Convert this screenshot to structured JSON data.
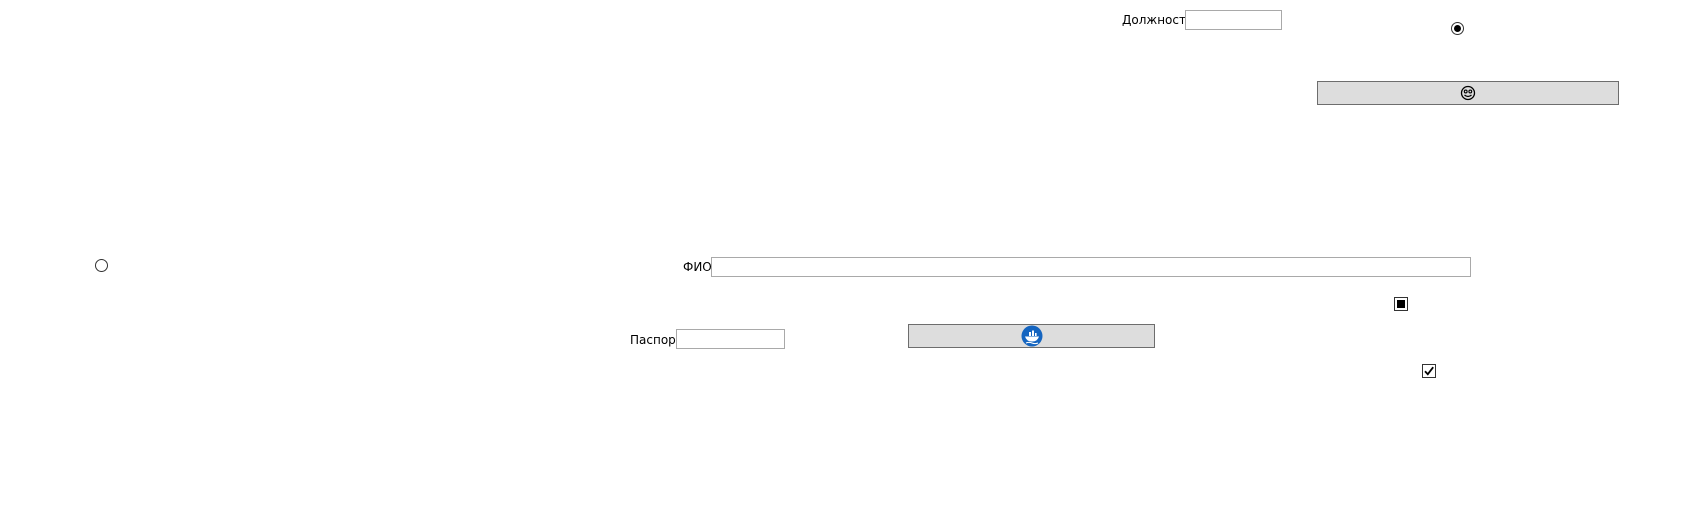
{
  "form": {
    "position_label": "Должность",
    "position_value": "",
    "fio_label": "ФИО",
    "fio_value": "",
    "passport_label": "Паспорт",
    "passport_value": ""
  },
  "controls": {
    "radio_top": {
      "checked": true
    },
    "radio_left": {
      "checked": false
    },
    "checkbox_indeterminate": {
      "state": "indeterminate"
    },
    "checkbox_checked": {
      "state": "checked"
    }
  },
  "buttons": {
    "top_button_icon": "face-icon",
    "bottom_button_icon": "ship-logo-icon"
  },
  "colors": {
    "button_bg": "#dddddd",
    "button_border": "#6d6d6d",
    "input_border": "#a9a9a9",
    "logo_blue": "#1565c0"
  }
}
